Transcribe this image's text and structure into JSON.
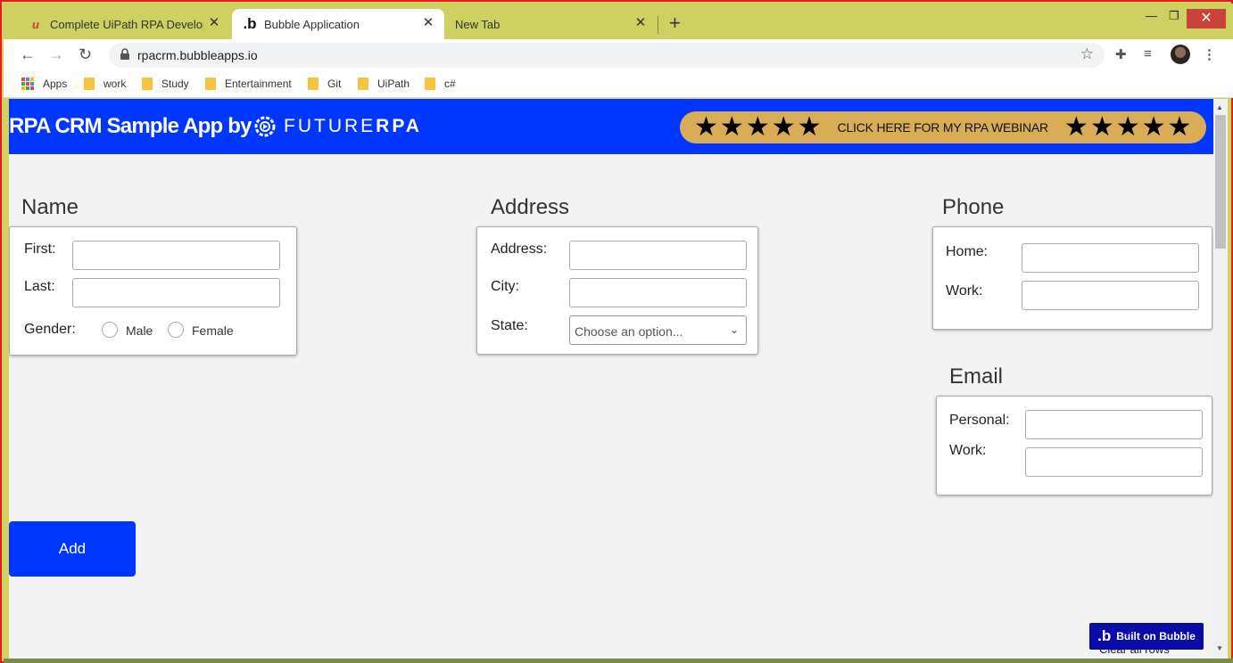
{
  "browser": {
    "tabs": [
      {
        "title": "Complete UiPath RPA Developer",
        "favicon": "udemy-icon",
        "active": false
      },
      {
        "title": "Bubble Application",
        "favicon": "bubble-icon",
        "active": true
      },
      {
        "title": "New Tab",
        "favicon": "",
        "active": false
      }
    ],
    "close_symbol": "✕",
    "new_tab_symbol": "+",
    "url": "rpacrm.bubbleapps.io",
    "bookmarks": [
      "Apps",
      "work",
      "Study",
      "Entertainment",
      "Git",
      "UiPath",
      "c#"
    ]
  },
  "header": {
    "title": "RPA CRM Sample App by",
    "logo_text_light": "FUTURE",
    "logo_text_bold": "RPA",
    "banner_text": "CLICK HERE FOR MY RPA WEBINAR",
    "banner_color": "#d9ad55",
    "brand_color": "#0036ff",
    "stars_each_side": 5
  },
  "name_section": {
    "title": "Name",
    "first_label": "First:",
    "last_label": "Last:",
    "gender_label": "Gender:",
    "gender_options": [
      "Male",
      "Female"
    ]
  },
  "address_section": {
    "title": "Address",
    "address_label": "Address:",
    "city_label": "City:",
    "state_label": "State:",
    "state_placeholder": "Choose an option..."
  },
  "phone_section": {
    "title": "Phone",
    "home_label": "Home:",
    "work_label": "Work:"
  },
  "email_section": {
    "title": "Email",
    "personal_label": "Personal:",
    "work_label": "Work:"
  },
  "actions": {
    "add_label": "Add"
  },
  "footer": {
    "badge_text": "Built on Bubble",
    "clear_rows_text": "Clear all rows"
  }
}
